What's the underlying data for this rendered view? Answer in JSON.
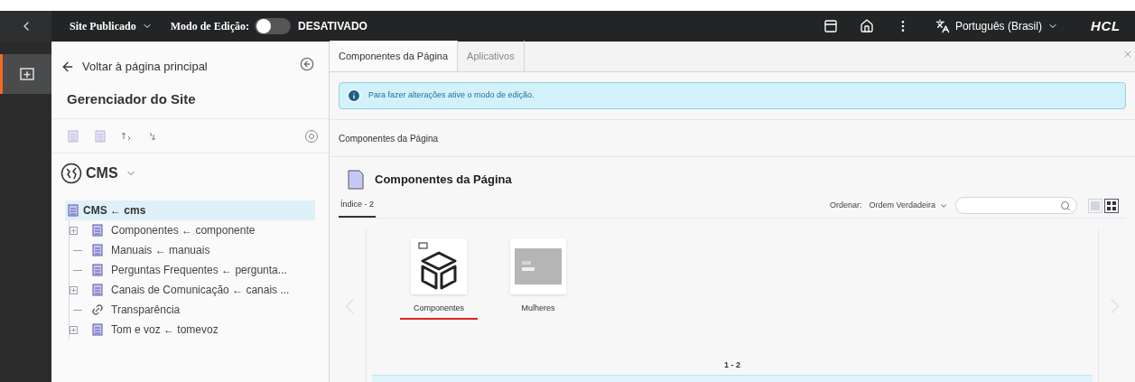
{
  "topbar": {
    "site_menu": "Site Publicado",
    "edit_mode_label": "Modo de Edição:",
    "edit_mode": {
      "on": false
    },
    "edit_mode_status": "DESATIVADO",
    "language": "Português (Brasil)",
    "logo": "HCL"
  },
  "sidebar": {
    "back_link": "Voltar à página principal",
    "title": "Gerenciador do Site",
    "site_selector": "CMS",
    "tree": [
      {
        "label": "CMS",
        "name": "cms",
        "arrow": "←",
        "selected": true,
        "children": [
          {
            "label": "Componentes",
            "name": "componente",
            "arrow": "←",
            "kind": "page",
            "expandable": true,
            "selected": false
          },
          {
            "label": "Manuais",
            "name": "manuais",
            "arrow": "←",
            "kind": "page",
            "expandable": false,
            "selected": false
          },
          {
            "label": "Perguntas Frequentes",
            "name": "pergunta...",
            "arrow": "←",
            "kind": "page",
            "expandable": false,
            "selected": false
          },
          {
            "label": "Canais de Comunicação",
            "name": "canais ...",
            "arrow": "←",
            "kind": "page",
            "expandable": true,
            "selected": false
          },
          {
            "label": "Transparência",
            "kind": "link",
            "expandable": false,
            "selected": false
          },
          {
            "label": "Tom e voz",
            "name": "tomevoz",
            "arrow": "←",
            "kind": "page",
            "expandable": true,
            "selected": false
          }
        ]
      }
    ]
  },
  "main": {
    "tabs": [
      {
        "label": "Componentes da Página",
        "selected": true
      },
      {
        "label": "Aplicativos",
        "selected": false
      }
    ],
    "alert": "Para fazer alterações ative o modo de edição.",
    "breadcrumb": "Componentes da Página",
    "title": "Componentes da Página",
    "index_tab": "Índice - 2",
    "sort_label": "Ordenar:",
    "sort_value": "Ordem Verdadeira",
    "view_modes": [
      {
        "kind": "list",
        "selected": false
      },
      {
        "kind": "grid",
        "selected": true
      }
    ],
    "tiles": [
      {
        "label": "Componentes",
        "kind": "folder",
        "selected": true
      },
      {
        "label": "Mulheres",
        "kind": "image",
        "selected": false
      }
    ],
    "pagination": "1 - 2"
  }
}
